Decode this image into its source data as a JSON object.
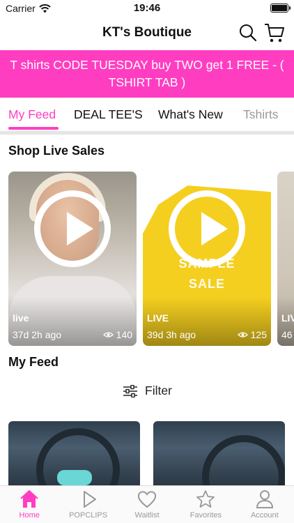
{
  "status_bar": {
    "carrier": "Carrier",
    "time": "19:46"
  },
  "nav": {
    "title": "KT's Boutique"
  },
  "promo": {
    "text": "T shirts CODE TUESDAY buy TWO get 1 FREE - ( TSHIRT TAB )"
  },
  "tabs": [
    {
      "label": "My Feed",
      "active": true
    },
    {
      "label": "DEAL TEE'S"
    },
    {
      "label": "What's New"
    },
    {
      "label": "Tshirts"
    }
  ],
  "live_sales": {
    "title": "Shop Live Sales",
    "cards": [
      {
        "tag": "live",
        "time": "37d 2h ago",
        "views": "140"
      },
      {
        "tag": "LIVE",
        "time": "39d 3h ago",
        "views": "125",
        "art_lines": [
          "SAMPLE",
          "SALE"
        ]
      },
      {
        "tag": "LIV",
        "time": "46"
      }
    ]
  },
  "feed": {
    "title": "My Feed",
    "filter_label": "Filter"
  },
  "tabbar": [
    {
      "label": "Home",
      "active": true,
      "icon": "home-icon"
    },
    {
      "label": "POPCLIPS",
      "icon": "play-icon"
    },
    {
      "label": "Waitlist",
      "icon": "heart-icon"
    },
    {
      "label": "Favorites",
      "icon": "star-icon"
    },
    {
      "label": "Account",
      "icon": "person-icon"
    }
  ],
  "colors": {
    "accent": "#ff3dc1",
    "yellow": "#f5cf1f"
  }
}
